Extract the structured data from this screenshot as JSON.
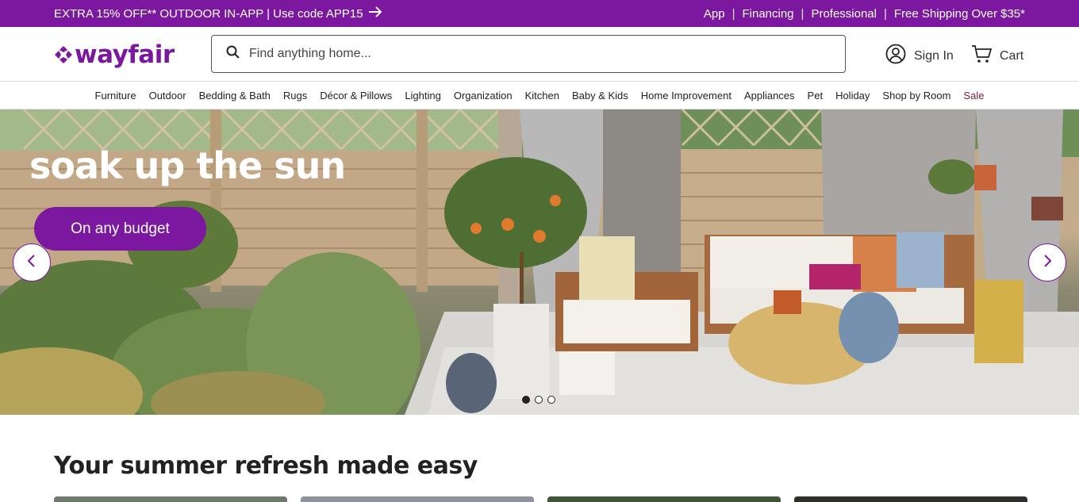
{
  "promo": {
    "left_text": "EXTRA 15% OFF** OUTDOOR IN-APP | Use code APP15",
    "links": [
      "App",
      "Financing",
      "Professional",
      "Free Shipping Over $35*"
    ]
  },
  "header": {
    "logo_text": "wayfair",
    "search_placeholder": "Find anything home...",
    "sign_in": "Sign In",
    "cart": "Cart"
  },
  "nav": {
    "items": [
      "Furniture",
      "Outdoor",
      "Bedding & Bath",
      "Rugs",
      "Décor & Pillows",
      "Lighting",
      "Organization",
      "Kitchen",
      "Baby & Kids",
      "Home Improvement",
      "Appliances",
      "Pet",
      "Holiday",
      "Shop by Room",
      "Sale"
    ]
  },
  "hero": {
    "title": "soak up the sun",
    "button": "On any budget",
    "slides": 3,
    "active_slide": 1
  },
  "section": {
    "title": "Your summer refresh made easy"
  },
  "colors": {
    "brand_purple": "#7b189f",
    "sale": "#7a1d3c"
  },
  "icons": [
    "arrow-right-icon",
    "search-icon",
    "user-icon",
    "cart-icon",
    "chevron-left-icon",
    "chevron-right-icon"
  ]
}
